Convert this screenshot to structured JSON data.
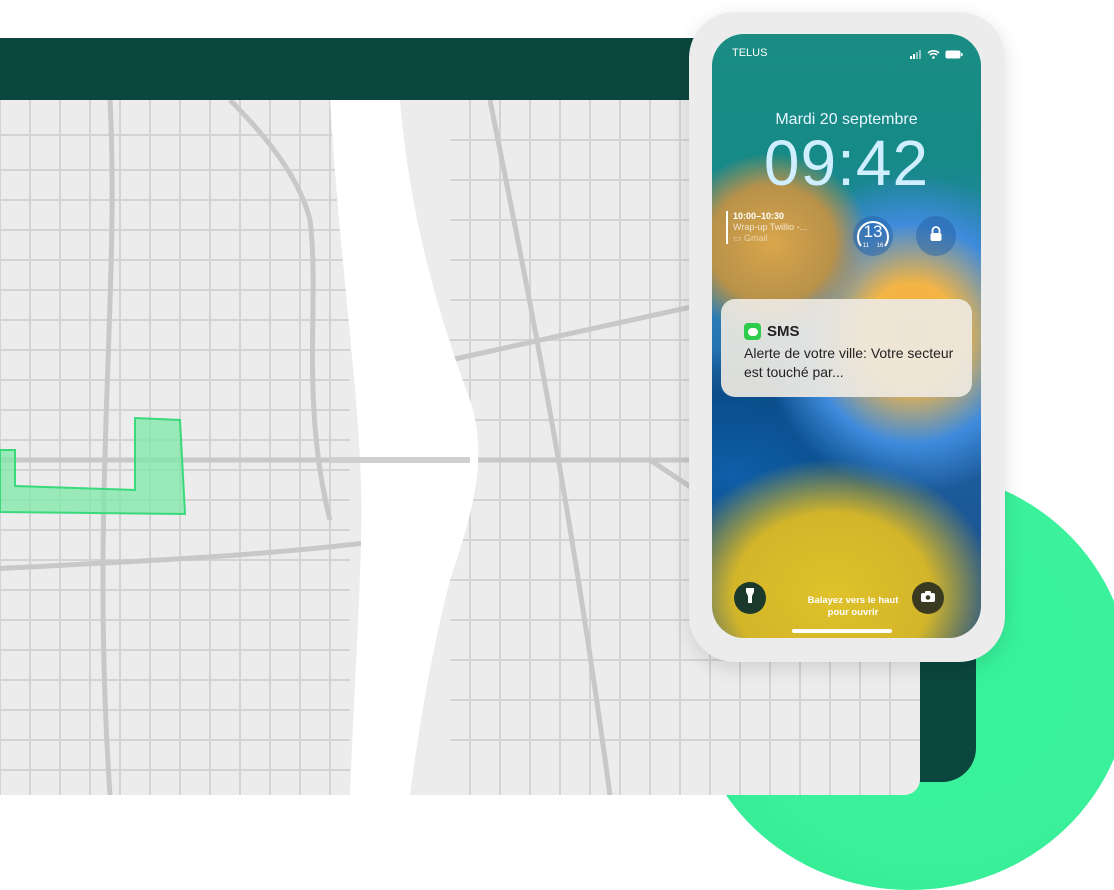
{
  "phone": {
    "carrier": "TELUS",
    "date": "Mardi 20 septembre",
    "time": "09:42",
    "calendar_widget": {
      "time_range": "10:00–10:30",
      "event": "Wrap-up Twillio -...",
      "source": "Gmail"
    },
    "ring_widget": {
      "value": "13",
      "min": "11",
      "max": "16"
    },
    "notification": {
      "app": "SMS",
      "message": "Alerte de votre ville: Votre secteur est touché par..."
    },
    "swipe_hint": [
      "Balayez vers le haut",
      "pour ouvrir"
    ]
  },
  "colors": {
    "tablet_frame": "#0b473f",
    "map_background": "#ececec",
    "map_roads": "#d3d3d3",
    "river": "#ffffff",
    "zone_fill": "#7ee8a8",
    "zone_stroke": "#39d97c",
    "blob": "#3cf19c"
  },
  "icons": {
    "flashlight": "flashlight-icon",
    "camera": "camera-icon",
    "lock": "lock-icon",
    "message": "message-icon",
    "signal": "signal-icon",
    "wifi": "wifi-icon",
    "battery": "battery-icon"
  }
}
